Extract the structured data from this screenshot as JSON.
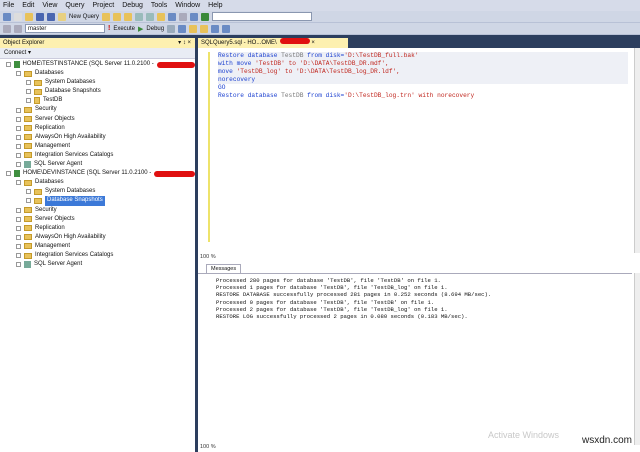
{
  "menu": [
    "File",
    "Edit",
    "View",
    "Query",
    "Project",
    "Debug",
    "Tools",
    "Window",
    "Help"
  ],
  "toolbar": {
    "new_query": "New Query",
    "database": "master",
    "execute": "Execute",
    "debug": "Debug"
  },
  "object_explorer": {
    "title": "Object Explorer",
    "pin": "▾ ↕ ×",
    "connect": "Connect ▾",
    "server1": "HOME\\TESTINSTANCE (SQL Server 11.0.2100 -",
    "server2": "HOME\\DEVINSTANCE (SQL Server 11.0.2100 -",
    "databases": "Databases",
    "system_databases": "System Databases",
    "database_snapshots": "Database Snapshots",
    "testdb": "TestDB",
    "folders": [
      "Security",
      "Server Objects",
      "Replication",
      "AlwaysOn High Availability",
      "Management",
      "Integration Services Catalogs",
      "SQL Server Agent"
    ]
  },
  "editor": {
    "tab": "SQLQuery5.sql - HO...OME\\",
    "tab_close": "×",
    "lines": [
      {
        "k1": "Restore database ",
        "id": "TestDB",
        "k2": " from disk=",
        "s": "'D:\\TestDB_full.bak'",
        "t": ""
      },
      {
        "k1": "with move ",
        "id": "",
        "k2": "",
        "s": "'TestDB'",
        "t": " to 'D:\\DATA\\TestDB_DR.mdf',"
      },
      {
        "k1": "move ",
        "id": "",
        "k2": "",
        "s": "'TestDB_log'",
        "t": " to 'D:\\DATA\\TestDB_log_DR.ldf',"
      },
      {
        "k1": "norecovery",
        "id": "",
        "k2": "",
        "s": "",
        "t": ""
      },
      {
        "k1": "GO",
        "id": "",
        "k2": "",
        "s": "",
        "t": ""
      },
      {
        "k1": "Restore database ",
        "id": "TestDB",
        "k2": " from disk=",
        "s": "'D:\\TestDB_log.trn'",
        "t": " with norecovery"
      }
    ],
    "zoom": "100 %",
    "messages_tab": "Messages",
    "messages": [
      "Processed 280 pages for database 'TestDB', file 'TestDB' on file 1.",
      "Processed 1 pages for database 'TestDB', file 'TestDB_log' on file 1.",
      "RESTORE DATABASE successfully processed 281 pages in 0.252 seconds (8.694 MB/sec).",
      "Processed 0 pages for database 'TestDB', file 'TestDB' on file 1.",
      "Processed 2 pages for database 'TestDB', file 'TestDB_log' on file 1.",
      "RESTORE LOG successfully processed 2 pages in 0.080 seconds (0.183 MB/sec)."
    ],
    "zoom_bottom": "100 %"
  },
  "watermark": "Activate Windows",
  "site": "wsxdn.com"
}
